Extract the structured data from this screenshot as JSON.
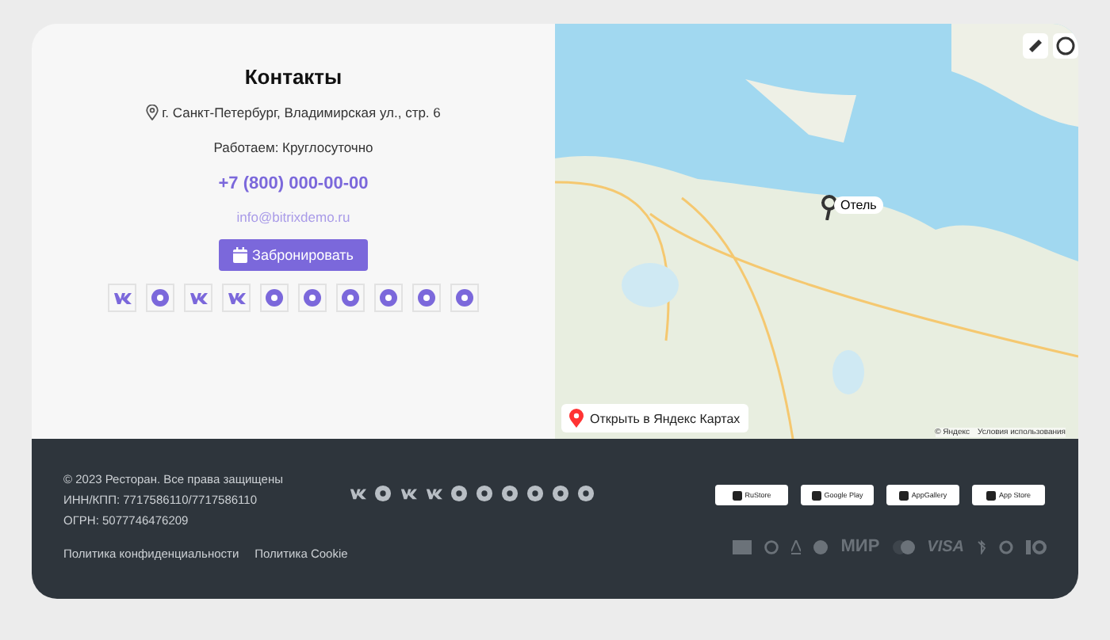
{
  "contacts": {
    "title": "Контакты",
    "address": "г. Санкт-Петербург, Владимирская ул., стр. 6",
    "hours": "Работаем: Круглосуточно",
    "phone": "+7 (800) 000-00-00",
    "email": "info@bitrixdemo.ru",
    "book_button": "Забронировать"
  },
  "map": {
    "pin_label": "Отель",
    "open_button": "Открыть в Яндекс Картах",
    "copyright": "© Яндекс",
    "terms": "Условия использования"
  },
  "footer": {
    "copyright": "© 2023 Ресторан. Все права защищены",
    "inn": "ИНН/КПП: 7717586110/7717586110",
    "ogrn": "ОГРН: 5077746476209",
    "links": [
      "Политика конфиденциальности",
      "Политика Cookie"
    ],
    "stores": [
      "RuStore",
      "Google Play",
      "AppGallery",
      "App Store"
    ],
    "payments": [
      "МИР",
      "VISA"
    ]
  }
}
